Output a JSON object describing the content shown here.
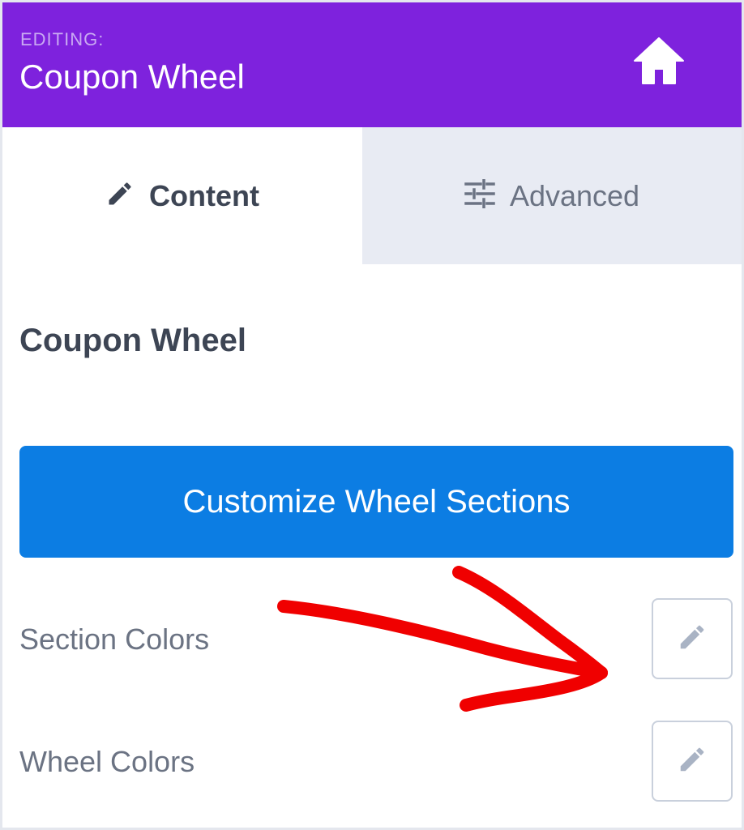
{
  "header": {
    "editing_label": "EDITING:",
    "title": "Coupon Wheel",
    "home_icon": "home-icon",
    "background_color": "#7e22dd"
  },
  "tabs": [
    {
      "label": "Content",
      "icon": "pencil-icon",
      "active": true
    },
    {
      "label": "Advanced",
      "icon": "sliders-icon",
      "active": false
    }
  ],
  "main": {
    "section_title": "Coupon Wheel",
    "primary_button_label": "Customize Wheel Sections",
    "primary_button_color": "#0c7de3",
    "settings": [
      {
        "label": "Section Colors",
        "action_icon": "pencil-icon"
      },
      {
        "label": "Wheel Colors",
        "action_icon": "pencil-icon"
      }
    ]
  },
  "annotation": {
    "type": "hand-drawn-arrow",
    "color": "#f00000",
    "points_to": "Section Colors edit button"
  }
}
